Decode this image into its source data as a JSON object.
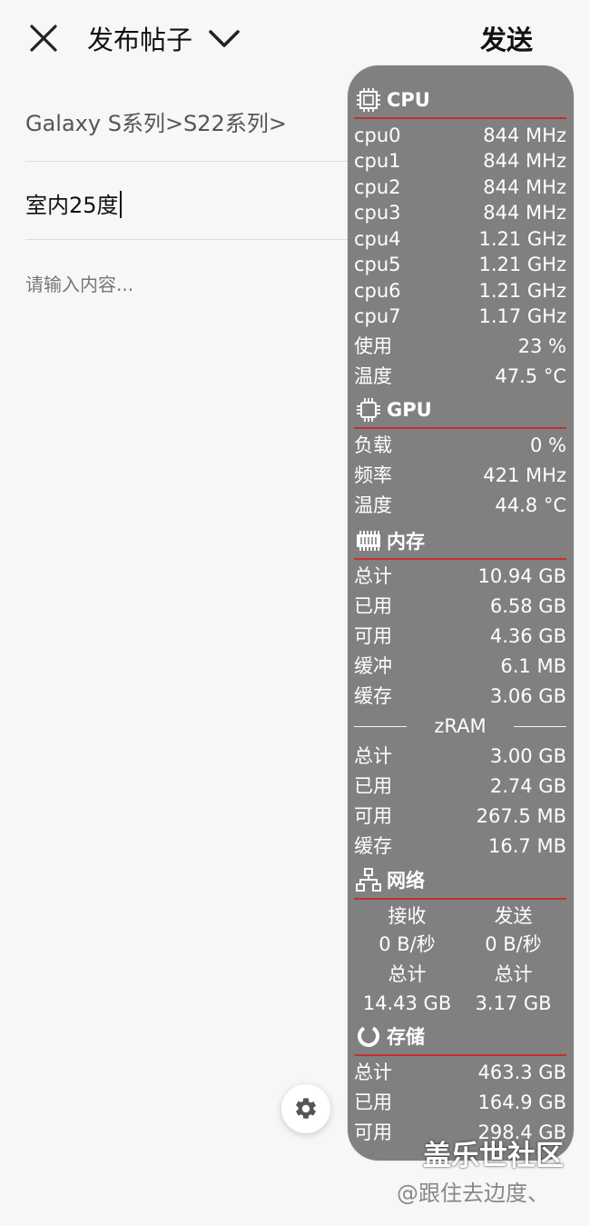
{
  "header": {
    "title": "发布帖子",
    "send_label": "发送"
  },
  "form": {
    "category": "Galaxy S系列>S22系列>",
    "title_value": "室内25度",
    "content_placeholder": "请输入内容..."
  },
  "monitor": {
    "cpu": {
      "label": "CPU",
      "cores": [
        {
          "name": "cpu0",
          "freq": "844 MHz"
        },
        {
          "name": "cpu1",
          "freq": "844 MHz"
        },
        {
          "name": "cpu2",
          "freq": "844 MHz"
        },
        {
          "name": "cpu3",
          "freq": "844 MHz"
        },
        {
          "name": "cpu4",
          "freq": "1.21 GHz"
        },
        {
          "name": "cpu5",
          "freq": "1.21 GHz"
        },
        {
          "name": "cpu6",
          "freq": "1.21 GHz"
        },
        {
          "name": "cpu7",
          "freq": "1.17 GHz"
        }
      ],
      "usage": {
        "label": "使用",
        "value": "23 %"
      },
      "temp": {
        "label": "温度",
        "value": "47.5 °C"
      }
    },
    "gpu": {
      "label": "GPU",
      "rows": [
        {
          "label": "负载",
          "value": "0 %"
        },
        {
          "label": "频率",
          "value": "421 MHz"
        },
        {
          "label": "温度",
          "value": "44.8 °C"
        }
      ]
    },
    "memory": {
      "label": "内存",
      "rows": [
        {
          "label": "总计",
          "value": "10.94 GB"
        },
        {
          "label": "已用",
          "value": "6.58 GB"
        },
        {
          "label": "可用",
          "value": "4.36 GB"
        },
        {
          "label": "缓冲",
          "value": "6.1 MB"
        },
        {
          "label": "缓存",
          "value": "3.06 GB"
        }
      ]
    },
    "zram": {
      "label": "zRAM",
      "rows": [
        {
          "label": "总计",
          "value": "3.00 GB"
        },
        {
          "label": "已用",
          "value": "2.74 GB"
        },
        {
          "label": "可用",
          "value": "267.5 MB"
        },
        {
          "label": "缓存",
          "value": "16.7 MB"
        }
      ]
    },
    "network": {
      "label": "网络",
      "receive_label": "接收",
      "send_label": "发送",
      "receive_rate": "0 B/秒",
      "send_rate": "0 B/秒",
      "total_label": "总计",
      "receive_total": "14.43 GB",
      "send_total": "3.17 GB"
    },
    "storage": {
      "label": "存储",
      "rows": [
        {
          "label": "总计",
          "value": "463.3 GB"
        },
        {
          "label": "已用",
          "value": "164.9 GB"
        },
        {
          "label": "可用",
          "value": "298.4 GB"
        }
      ]
    }
  },
  "watermark": {
    "site": "盖乐世社区",
    "user": "@跟住去边度、"
  }
}
